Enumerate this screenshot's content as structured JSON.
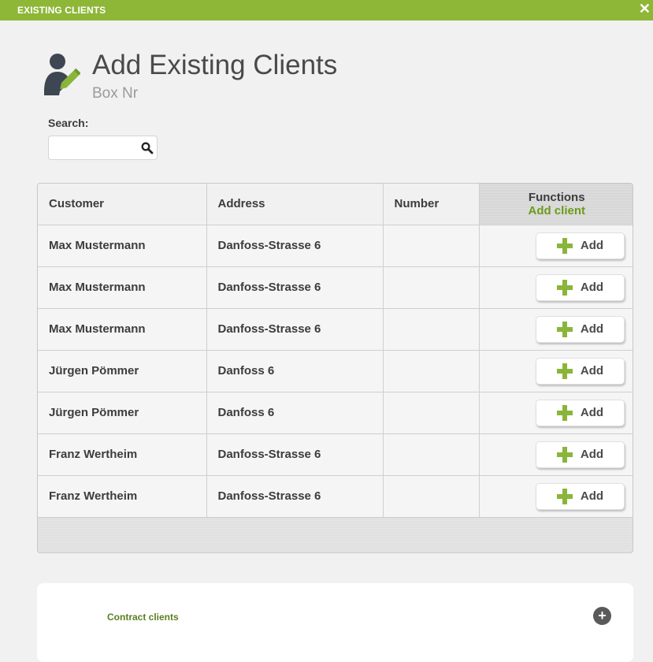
{
  "window": {
    "title": "EXISTING CLIENTS",
    "close_glyph": "✕"
  },
  "page": {
    "title": "Add Existing Clients",
    "subtitle": "Box Nr",
    "icon": "user-edit-icon"
  },
  "search": {
    "label": "Search:",
    "value": "",
    "placeholder": ""
  },
  "table": {
    "columns": [
      "Customer",
      "Address",
      "Number",
      "Functions"
    ],
    "functions_sub": "Add client",
    "rows": [
      {
        "customer": "Max Mustermann",
        "address": "Danfoss-Strasse 6",
        "number": "",
        "action": "Add"
      },
      {
        "customer": "Max Mustermann",
        "address": "Danfoss-Strasse 6",
        "number": "",
        "action": "Add"
      },
      {
        "customer": "Max Mustermann",
        "address": "Danfoss-Strasse 6",
        "number": "",
        "action": "Add"
      },
      {
        "customer": "Jürgen Pömmer",
        "address": "Danfoss 6",
        "number": "",
        "action": "Add"
      },
      {
        "customer": "Jürgen Pömmer",
        "address": "Danfoss 6",
        "number": "",
        "action": "Add"
      },
      {
        "customer": "Franz Wertheim",
        "address": "Danfoss-Strasse 6",
        "number": "",
        "action": "Add"
      },
      {
        "customer": "Franz Wertheim",
        "address": "Danfoss-Strasse 6",
        "number": "",
        "action": "Add"
      }
    ]
  },
  "contract": {
    "label": "Contract clients",
    "expand_glyph": "+"
  },
  "colors": {
    "accent": "#8eb637",
    "accent_text": "#6b9b1e",
    "icon_dark": "#3d4652"
  }
}
